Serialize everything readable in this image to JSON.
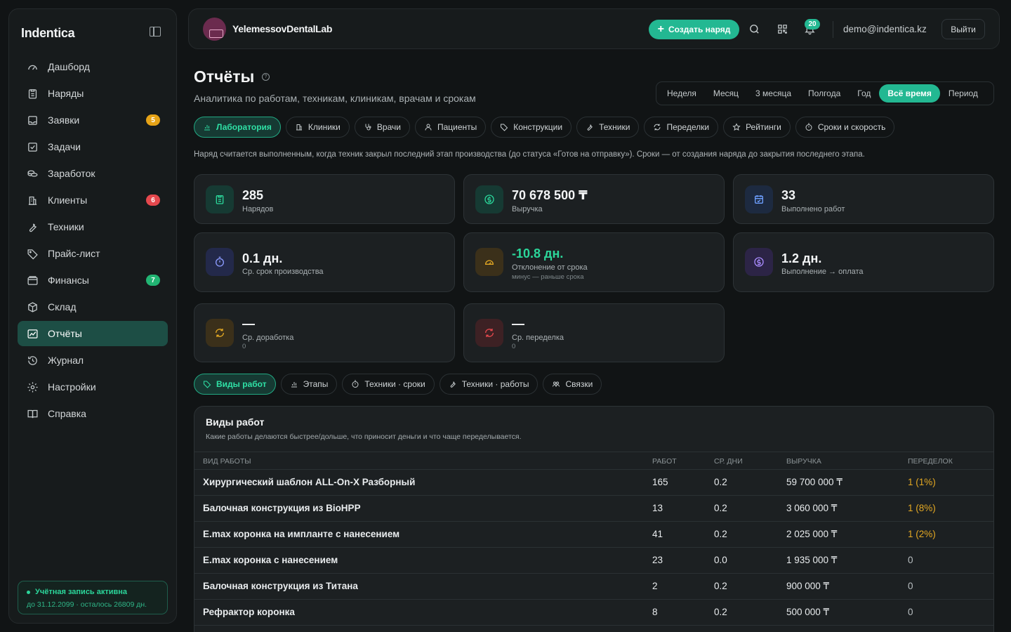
{
  "sidebar": {
    "brand": "Indentica",
    "items": [
      {
        "label": "Дашборд"
      },
      {
        "label": "Наряды"
      },
      {
        "label": "Заявки",
        "badge": "5",
        "badge_color": "#e6a317"
      },
      {
        "label": "Задачи"
      },
      {
        "label": "Заработок"
      },
      {
        "label": "Клиенты",
        "badge": "6",
        "badge_color": "#e5484d"
      },
      {
        "label": "Техники"
      },
      {
        "label": "Прайс-лист"
      },
      {
        "label": "Финансы",
        "badge": "7",
        "badge_color": "#22b573"
      },
      {
        "label": "Склад"
      },
      {
        "label": "Отчёты",
        "active": true
      },
      {
        "label": "Журнал"
      },
      {
        "label": "Настройки"
      },
      {
        "label": "Справка"
      }
    ],
    "account": {
      "title": "Учётная запись активна",
      "subtitle": "до 31.12.2099 · осталось 26809 дн."
    }
  },
  "header": {
    "org_name": "YelemessovDentalLab",
    "create_label": "Создать наряд",
    "notifications_count": "20",
    "email": "demo@indentica.kz",
    "logout_label": "Выйти"
  },
  "page": {
    "title": "Отчёты",
    "subtitle": "Аналитика по работам, техникам, клиникам, врачам и срокам",
    "note": "Наряд считается выполненным, когда техник закрыл последний этап производства (до статуса «Готов на отправку»). Сроки — от создания наряда до закрытия последнего этапа."
  },
  "periods": [
    "Неделя",
    "Месяц",
    "3 месяца",
    "Полгода",
    "Год",
    "Всё время",
    "Период"
  ],
  "active_period": "Всё время",
  "tabs": [
    "Лаборатория",
    "Клиники",
    "Врачи",
    "Пациенты",
    "Конструкции",
    "Техники",
    "Переделки",
    "Рейтинги",
    "Сроки и скорость"
  ],
  "kpis": {
    "orders": {
      "value": "285",
      "label": "Нарядов"
    },
    "revenue": {
      "value": "70 678 500 ₸",
      "label": "Выручка"
    },
    "works_done": {
      "value": "33",
      "label": "Выполнено работ"
    },
    "avg_production": {
      "value": "0.1 дн.",
      "label": "Ср. срок производства"
    },
    "deviation": {
      "value": "-10.8 дн.",
      "label": "Отклонение от срока",
      "sub": "минус — раньше срока"
    },
    "payment": {
      "value": "1.2 дн.",
      "label": "Выполнение → оплата"
    },
    "rework": {
      "value": "—",
      "label": "Ср. доработка",
      "sub": "0"
    },
    "redo": {
      "value": "—",
      "label": "Ср. переделка",
      "sub": "0"
    }
  },
  "subtabs": [
    "Виды работ",
    "Этапы",
    "Техники · сроки",
    "Техники · работы",
    "Связки"
  ],
  "table": {
    "title": "Виды работ",
    "subtitle": "Какие работы делаются быстрее/дольше, что приносит деньги и что чаще переделывается.",
    "columns": [
      "ВИД РАБОТЫ",
      "РАБОТ",
      "СР. ДНИ",
      "ВЫРУЧКА",
      "ПЕРЕДЕЛОК"
    ],
    "rows": [
      {
        "name": "Хирургический шаблон ALL-On-X Разборный",
        "count": "165",
        "days": "0.2",
        "revenue": "59 700 000 ₸",
        "redo": "1 (1%)"
      },
      {
        "name": "Балочная конструкция из BioHPP",
        "count": "13",
        "days": "0.2",
        "revenue": "3 060 000 ₸",
        "redo": "1 (8%)"
      },
      {
        "name": "E.max коронка на импланте с нанесением",
        "count": "41",
        "days": "0.2",
        "revenue": "2 025 000 ₸",
        "redo": "1 (2%)"
      },
      {
        "name": "E.max коронка с нанесением",
        "count": "23",
        "days": "0.0",
        "revenue": "1 935 000 ₸",
        "redo": "0"
      },
      {
        "name": "Балочная конструкция из Титана",
        "count": "2",
        "days": "0.2",
        "revenue": "900 000 ₸",
        "redo": "0"
      },
      {
        "name": "Рефрактор коронка",
        "count": "8",
        "days": "0.2",
        "revenue": "500 000 ₸",
        "redo": "0"
      }
    ]
  },
  "colors": {
    "accent": "#23b892",
    "warning": "#e3a823",
    "background": "#111415"
  }
}
